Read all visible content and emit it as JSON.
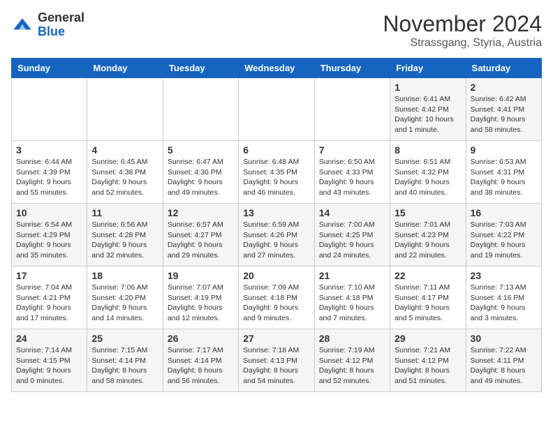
{
  "header": {
    "logo_line1": "General",
    "logo_line2": "Blue",
    "month": "November 2024",
    "location": "Strassgang, Styria, Austria"
  },
  "weekdays": [
    "Sunday",
    "Monday",
    "Tuesday",
    "Wednesday",
    "Thursday",
    "Friday",
    "Saturday"
  ],
  "weeks": [
    [
      {
        "day": "",
        "info": ""
      },
      {
        "day": "",
        "info": ""
      },
      {
        "day": "",
        "info": ""
      },
      {
        "day": "",
        "info": ""
      },
      {
        "day": "",
        "info": ""
      },
      {
        "day": "1",
        "info": "Sunrise: 6:41 AM\nSunset: 4:42 PM\nDaylight: 10 hours\nand 1 minute."
      },
      {
        "day": "2",
        "info": "Sunrise: 6:42 AM\nSunset: 4:41 PM\nDaylight: 9 hours\nand 58 minutes."
      }
    ],
    [
      {
        "day": "3",
        "info": "Sunrise: 6:44 AM\nSunset: 4:39 PM\nDaylight: 9 hours\nand 55 minutes."
      },
      {
        "day": "4",
        "info": "Sunrise: 6:45 AM\nSunset: 4:38 PM\nDaylight: 9 hours\nand 52 minutes."
      },
      {
        "day": "5",
        "info": "Sunrise: 6:47 AM\nSunset: 4:36 PM\nDaylight: 9 hours\nand 49 minutes."
      },
      {
        "day": "6",
        "info": "Sunrise: 6:48 AM\nSunset: 4:35 PM\nDaylight: 9 hours\nand 46 minutes."
      },
      {
        "day": "7",
        "info": "Sunrise: 6:50 AM\nSunset: 4:33 PM\nDaylight: 9 hours\nand 43 minutes."
      },
      {
        "day": "8",
        "info": "Sunrise: 6:51 AM\nSunset: 4:32 PM\nDaylight: 9 hours\nand 40 minutes."
      },
      {
        "day": "9",
        "info": "Sunrise: 6:53 AM\nSunset: 4:31 PM\nDaylight: 9 hours\nand 38 minutes."
      }
    ],
    [
      {
        "day": "10",
        "info": "Sunrise: 6:54 AM\nSunset: 4:29 PM\nDaylight: 9 hours\nand 35 minutes."
      },
      {
        "day": "11",
        "info": "Sunrise: 6:56 AM\nSunset: 4:28 PM\nDaylight: 9 hours\nand 32 minutes."
      },
      {
        "day": "12",
        "info": "Sunrise: 6:57 AM\nSunset: 4:27 PM\nDaylight: 9 hours\nand 29 minutes."
      },
      {
        "day": "13",
        "info": "Sunrise: 6:59 AM\nSunset: 4:26 PM\nDaylight: 9 hours\nand 27 minutes."
      },
      {
        "day": "14",
        "info": "Sunrise: 7:00 AM\nSunset: 4:25 PM\nDaylight: 9 hours\nand 24 minutes."
      },
      {
        "day": "15",
        "info": "Sunrise: 7:01 AM\nSunset: 4:23 PM\nDaylight: 9 hours\nand 22 minutes."
      },
      {
        "day": "16",
        "info": "Sunrise: 7:03 AM\nSunset: 4:22 PM\nDaylight: 9 hours\nand 19 minutes."
      }
    ],
    [
      {
        "day": "17",
        "info": "Sunrise: 7:04 AM\nSunset: 4:21 PM\nDaylight: 9 hours\nand 17 minutes."
      },
      {
        "day": "18",
        "info": "Sunrise: 7:06 AM\nSunset: 4:20 PM\nDaylight: 9 hours\nand 14 minutes."
      },
      {
        "day": "19",
        "info": "Sunrise: 7:07 AM\nSunset: 4:19 PM\nDaylight: 9 hours\nand 12 minutes."
      },
      {
        "day": "20",
        "info": "Sunrise: 7:09 AM\nSunset: 4:18 PM\nDaylight: 9 hours\nand 9 minutes."
      },
      {
        "day": "21",
        "info": "Sunrise: 7:10 AM\nSunset: 4:18 PM\nDaylight: 9 hours\nand 7 minutes."
      },
      {
        "day": "22",
        "info": "Sunrise: 7:11 AM\nSunset: 4:17 PM\nDaylight: 9 hours\nand 5 minutes."
      },
      {
        "day": "23",
        "info": "Sunrise: 7:13 AM\nSunset: 4:16 PM\nDaylight: 9 hours\nand 3 minutes."
      }
    ],
    [
      {
        "day": "24",
        "info": "Sunrise: 7:14 AM\nSunset: 4:15 PM\nDaylight: 9 hours\nand 0 minutes."
      },
      {
        "day": "25",
        "info": "Sunrise: 7:15 AM\nSunset: 4:14 PM\nDaylight: 8 hours\nand 58 minutes."
      },
      {
        "day": "26",
        "info": "Sunrise: 7:17 AM\nSunset: 4:14 PM\nDaylight: 8 hours\nand 56 minutes."
      },
      {
        "day": "27",
        "info": "Sunrise: 7:18 AM\nSunset: 4:13 PM\nDaylight: 8 hours\nand 54 minutes."
      },
      {
        "day": "28",
        "info": "Sunrise: 7:19 AM\nSunset: 4:12 PM\nDaylight: 8 hours\nand 52 minutes."
      },
      {
        "day": "29",
        "info": "Sunrise: 7:21 AM\nSunset: 4:12 PM\nDaylight: 8 hours\nand 51 minutes."
      },
      {
        "day": "30",
        "info": "Sunrise: 7:22 AM\nSunset: 4:11 PM\nDaylight: 8 hours\nand 49 minutes."
      }
    ]
  ]
}
